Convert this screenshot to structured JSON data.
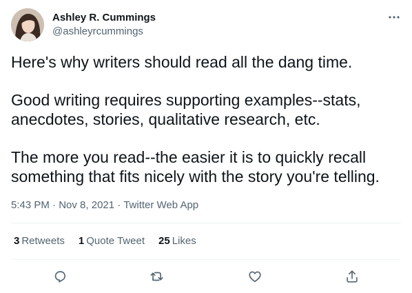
{
  "author": {
    "display_name": "Ashley R. Cummings",
    "handle": "@ashleyrcummings"
  },
  "tweet": {
    "paragraphs": [
      "Here's why writers should read all the dang time.",
      "Good writing requires supporting examples--stats, anecdotes, stories, qualitative research, etc.",
      "The more you read--the easier it is to quickly recall something that fits nicely with the story you're telling."
    ],
    "time": "5:43 PM",
    "separator": "·",
    "date": "Nov 8, 2021",
    "source": "Twitter Web App"
  },
  "stats": {
    "retweets_count": "3",
    "retweets_label": "Retweets",
    "quotes_count": "1",
    "quotes_label": "Quote Tweet",
    "likes_count": "25",
    "likes_label": "Likes"
  },
  "icons": {
    "more": "more-icon",
    "reply": "reply-icon",
    "retweet": "retweet-icon",
    "like": "like-icon",
    "share": "share-icon"
  },
  "colors": {
    "text_primary": "#0f1419",
    "text_secondary": "#536471",
    "divider": "#eff3f4"
  }
}
